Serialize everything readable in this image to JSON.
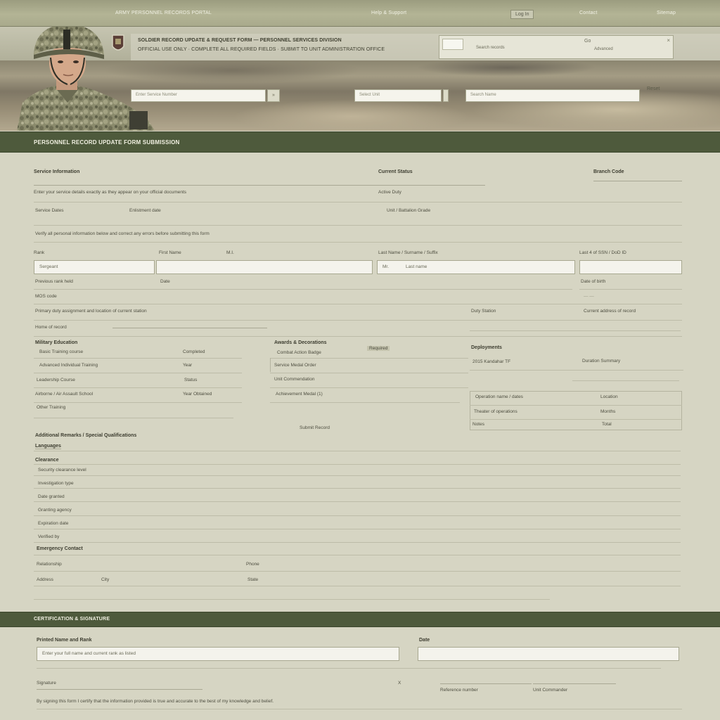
{
  "topnav": {
    "site_title": "ARMY PERSONNEL RECORDS PORTAL",
    "center_link": "Help & Support",
    "button": "Log In",
    "link_1": "Contact",
    "link_2": "Sitemap"
  },
  "hero": {
    "title_line_1": "SOLDIER RECORD UPDATE & REQUEST FORM — PERSONNEL SERVICES DIVISION",
    "title_line_2": "OFFICIAL USE ONLY · COMPLETE ALL REQUIRED FIELDS · SUBMIT TO UNIT ADMINISTRATION OFFICE",
    "search_placeholder": "Search records",
    "search_go": "Go",
    "search_sub": "Advanced",
    "close": "×",
    "field_1": "Enter Service Number",
    "field_2": "Select Unit",
    "field_3": "Search Name",
    "field_btn": "»",
    "field_link": "Reset"
  },
  "section1": {
    "title": "PERSONNEL RECORD UPDATE FORM SUBMISSION"
  },
  "form": {
    "service_info": "Service Information",
    "status": "Current Status",
    "branch_label": "Branch Code",
    "desc_line": "Enter your service details exactly as they appear on your official documents",
    "status_val": "Active Duty",
    "row2_a": "Service Dates",
    "row2_b": "Enlistment date",
    "row2_c": "Unit / Battalion",
    "row2_d": "Grade",
    "instructions": "Verify all personal information below and correct any errors before submitting this form",
    "col_rank": "Rank",
    "col_first": "First Name",
    "col_mid": "M.I.",
    "col_last": "Last Name / Surname / Suffix",
    "col_id": "Last 4 of SSN / DoD ID",
    "input_rank": "Sergeant",
    "input_last": "Last name",
    "input_last_prefix": "Mr.",
    "sub_a": "Previous rank held",
    "sub_b": "Date",
    "sub_c": "Date of birth",
    "sub_d": "MOS code",
    "line_a": "Primary duty assignment and location of current station",
    "line_b": "Duty Station",
    "line_c": "Current address of record",
    "line_d": "Home of record",
    "mil_head": "Military Education",
    "mil_1": "Basic Training course",
    "mil_1_val": "Completed",
    "mil_2": "Advanced Individual Training",
    "mil_2_val": "Year",
    "mil_3": "Leadership Course",
    "mil_3_val": "Status",
    "mil_4": "Airborne / Air Assault School",
    "mil_4_val": "Year Obtained",
    "mil_5": "Other Training",
    "awards_head": "Awards & Decorations",
    "awards_tag": "Required",
    "aw_1": "Combat Action Badge",
    "aw_2": "Service Medal Order",
    "aw_3": "Unit Commendation",
    "aw_4": "Achievement Medal (1)",
    "aw_5": "Submit Record",
    "deploy_head": "Deployments",
    "dp_1": "2015  Kandahar  TF",
    "dp_1_val": "Duration Summary",
    "dp_2": "Operation name / dates",
    "dp_2_val": "Location",
    "dp_3": "Theater of operations",
    "dp_3_val": "Months",
    "dp_4": "Notes",
    "dp_4_val": "Total",
    "remarks_head": "Additional Remarks / Special Qualifications",
    "remarks_sub": "Languages",
    "r_head": "Clearance",
    "r_1": "Security clearance level",
    "r_2": "Investigation type",
    "r_3": "Date granted",
    "r_4": "Granting agency",
    "r_5": "Expiration date",
    "r_6": "Verified by",
    "r_7": "Emergency Contact",
    "ec_1": "Relationship",
    "ec_1_val": "Phone",
    "ec_2": "Address",
    "ec_2_mid": "City",
    "ec_2_val": "State"
  },
  "section2": {
    "title": "CERTIFICATION & SIGNATURE"
  },
  "cert": {
    "name_label": "Printed Name and Rank",
    "name_value": "Enter your full name and current rank as listed",
    "date_label": "Date",
    "sig_label": "Signature",
    "x_mark": "X",
    "ref_1": "Reference number",
    "ref_2": "Unit Commander",
    "disclaimer": "By signing this form I certify that the information provided is true and accurate to the best of my knowledge and belief."
  },
  "colors": {
    "olive_bar": "#4e5a3c",
    "page_bg": "#d6d5c3",
    "nav_bg": "#b3b495"
  }
}
